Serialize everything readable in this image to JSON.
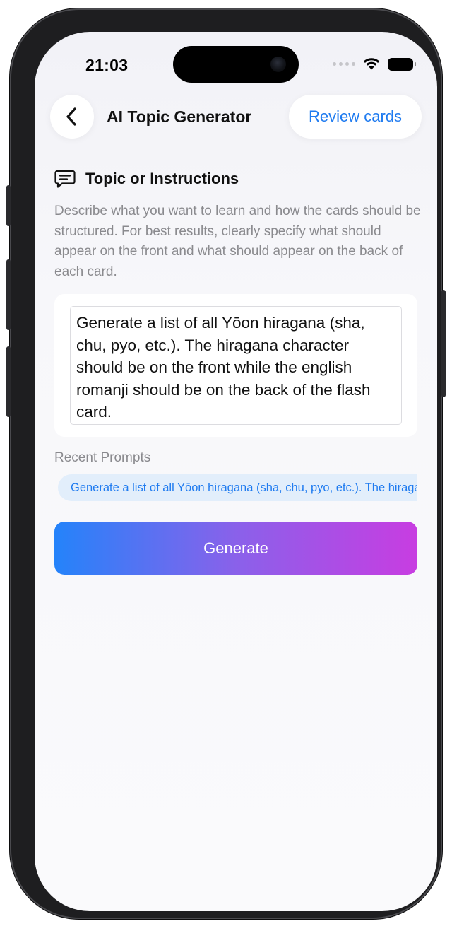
{
  "status_bar": {
    "time": "21:03"
  },
  "nav": {
    "title": "AI Topic Generator",
    "review_label": "Review cards"
  },
  "section": {
    "title": "Topic or Instructions",
    "description": "Describe what you want to learn and how the cards should be structured. For best results, clearly specify what should appear on the front and what should appear on the back of each card."
  },
  "input": {
    "value": "Generate a list of all Yōon hiragana (sha, chu, pyo, etc.). The hiragana character should be on the front while the english romanji should be on the back of the flash card."
  },
  "recent": {
    "label": "Recent Prompts",
    "items": [
      "Generate a list of all Yōon hiragana (sha, chu, pyo, etc.). The hiragana character should be on the front while the english romanji should be on the back of the flash card."
    ]
  },
  "generate": {
    "label": "Generate"
  },
  "colors": {
    "accent": "#1f7bf0",
    "gradient_start": "#2483fa",
    "gradient_end": "#c83de1",
    "chip_bg": "#e2eefb"
  }
}
